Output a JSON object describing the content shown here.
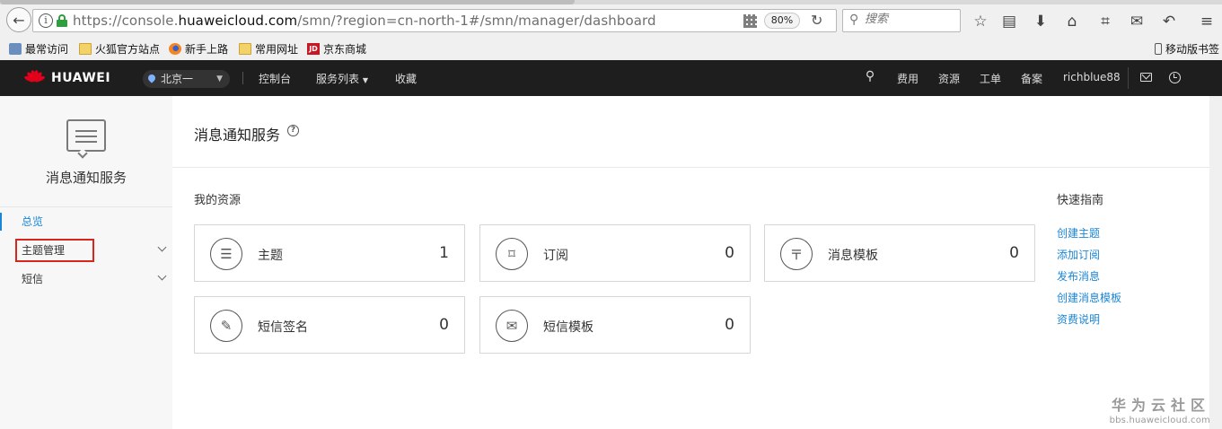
{
  "browser": {
    "url_prefix": "https://console.",
    "url_domain": "huaweicloud.com",
    "url_path": "/smn/?region=cn-north-1#/smn/manager/dashboard",
    "zoom": "80%",
    "search_placeholder": "搜索",
    "bookmarks": [
      "最常访问",
      "火狐官方站点",
      "新手上路",
      "常用网址",
      "京东商城"
    ],
    "mobile_bookmarks": "移动版书签"
  },
  "topnav": {
    "brand": "HUAWEI",
    "region": "北京一",
    "links": {
      "console": "控制台",
      "services": "服务列表",
      "favorites": "收藏",
      "billing": "费用",
      "resources": "资源",
      "tickets": "工单",
      "filing": "备案",
      "user": "richblue88"
    }
  },
  "sidebar": {
    "service_title": "消息通知服务",
    "items": [
      {
        "label": "总览"
      },
      {
        "label": "主题管理"
      },
      {
        "label": "短信"
      }
    ]
  },
  "main": {
    "title": "消息通知服务",
    "resources_title": "我的资源",
    "resources": [
      {
        "name": "主题",
        "count": "1",
        "icon": "topic-icon"
      },
      {
        "name": "订阅",
        "count": "0",
        "icon": "subscription-icon"
      },
      {
        "name": "消息模板",
        "count": "0",
        "icon": "message-template-icon"
      },
      {
        "name": "短信签名",
        "count": "0",
        "icon": "sms-signature-icon"
      },
      {
        "name": "短信模板",
        "count": "0",
        "icon": "sms-template-icon"
      }
    ],
    "guide_title": "快速指南",
    "guide_links": [
      "创建主题",
      "添加订阅",
      "发布消息",
      "创建消息模板",
      "资费说明"
    ]
  },
  "watermark": {
    "cn": "华为云社区",
    "url": "bbs.huaweicloud.com"
  },
  "colors": {
    "accent": "#1a86d6",
    "topnav_bg": "#1e1e1e",
    "highlight": "#d9261c"
  }
}
